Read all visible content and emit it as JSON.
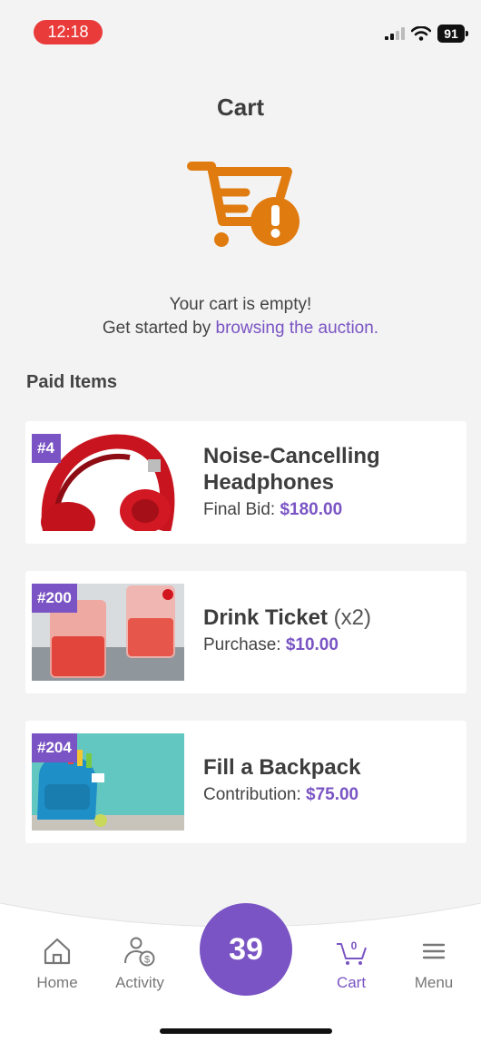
{
  "status": {
    "time": "12:18",
    "battery": "91"
  },
  "header": {
    "title": "Cart"
  },
  "empty_state": {
    "line1": "Your cart is empty!",
    "line2_prefix": "Get started by ",
    "link_text": "browsing the auction."
  },
  "paid_section": {
    "title": "Paid Items"
  },
  "items": [
    {
      "badge": "#4",
      "name": "Noise-Cancelling Headphones",
      "qty": "",
      "price_label": "Final Bid:",
      "price": "$180.00",
      "image": "red-headphones"
    },
    {
      "badge": "#200",
      "name": "Drink Ticket",
      "qty": "(x2)",
      "price_label": "Purchase:",
      "price": "$10.00",
      "image": "red-drinks"
    },
    {
      "badge": "#204",
      "name": "Fill a Backpack",
      "qty": "",
      "price_label": "Contribution:",
      "price": "$75.00",
      "image": "blue-backpack"
    }
  ],
  "nav": {
    "home": "Home",
    "activity": "Activity",
    "count": "39",
    "cart": "Cart",
    "cart_badge": "0",
    "menu": "Menu"
  },
  "colors": {
    "accent": "#7a54c4",
    "cart_icon": "#e07b10",
    "time_pill": "#ea3b3b"
  }
}
